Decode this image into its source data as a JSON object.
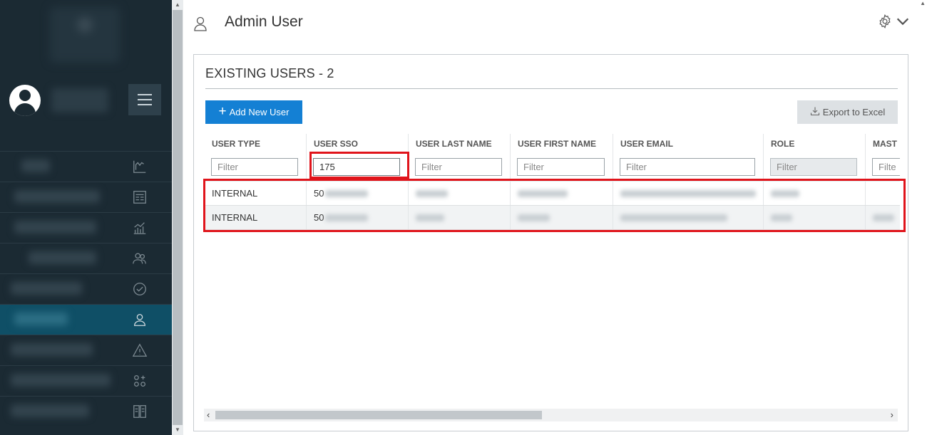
{
  "header": {
    "title": "Admin User",
    "user_icon": "user-outline-icon",
    "settings_icon": "gear-icon"
  },
  "sidebar": {
    "menu_icon": "hamburger-icon",
    "nav_icons": [
      "chart-line-icon",
      "report-icon",
      "analytics-icon",
      "users-group-icon",
      "check-circle-icon",
      "user-icon",
      "warning-icon",
      "add-group-icon",
      "columns-icon"
    ],
    "active_index": 5
  },
  "panel": {
    "title": "EXISTING USERS - 2",
    "add_button_label": "Add New User",
    "export_button_label": "Export to Excel"
  },
  "table": {
    "columns": [
      "USER TYPE",
      "USER SSO",
      "USER LAST NAME",
      "USER FIRST NAME",
      "USER EMAIL",
      "ROLE",
      "MAST"
    ],
    "filter_placeholder": "Filter",
    "filter_truncated": "Filte",
    "filters": {
      "user_sso": "175"
    },
    "rows": [
      {
        "user_type": "INTERNAL",
        "user_sso": "50"
      },
      {
        "user_type": "INTERNAL",
        "user_sso": "50"
      }
    ]
  },
  "colors": {
    "sidebar_bg": "#1b2a33",
    "active_nav": "#0f4f66",
    "primary_button": "#1480d4",
    "annotation": "#e0141b"
  }
}
